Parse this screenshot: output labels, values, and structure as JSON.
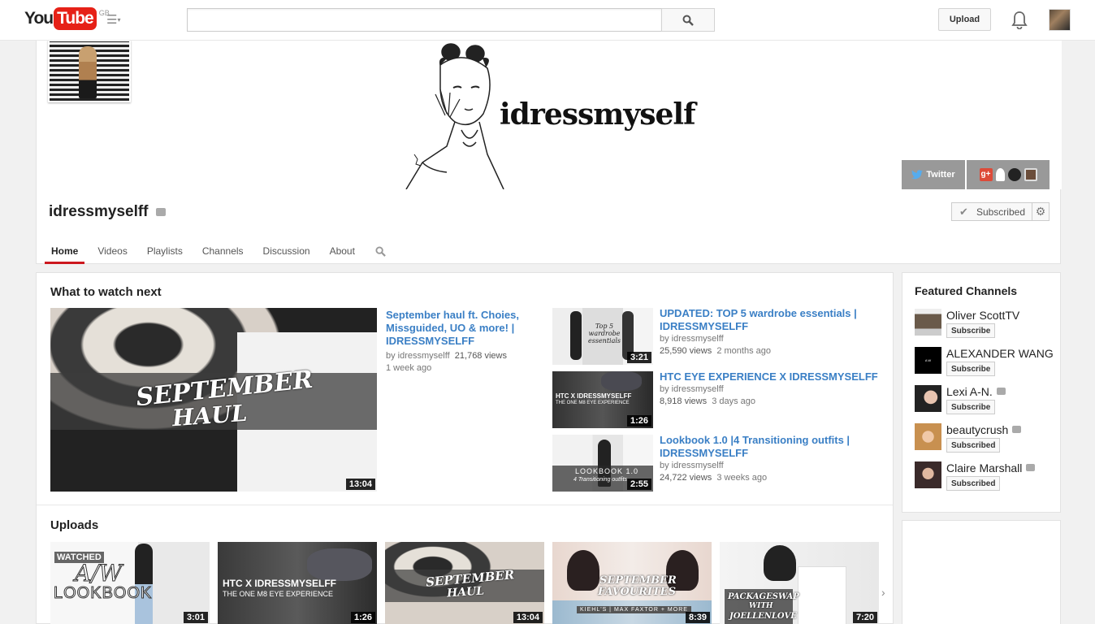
{
  "masthead": {
    "logo_you": "You",
    "logo_tube": "Tube",
    "region": "GB",
    "search_placeholder": "",
    "upload_label": "Upload"
  },
  "channel": {
    "banner_name": "idressmyself",
    "title": "idressmyselff",
    "social": {
      "twitter_label": "Twitter"
    },
    "subscribe_label": "Subscribed"
  },
  "tabs": [
    {
      "label": "Home",
      "active": true
    },
    {
      "label": "Videos"
    },
    {
      "label": "Playlists"
    },
    {
      "label": "Channels"
    },
    {
      "label": "Discussion"
    },
    {
      "label": "About"
    }
  ],
  "what_to_watch": {
    "heading": "What to watch next",
    "featured": {
      "thumb_text_1": "SEPTEMBER",
      "thumb_text_2": "HAUL",
      "duration": "13:04",
      "title": "September haul ft. Choies, Missguided, UO & more! | IDRESSMYSELFF",
      "by": "by idressmyselff",
      "views": "21,768 views",
      "age": "1 week ago"
    },
    "list": [
      {
        "title": "UPDATED: TOP 5 wardrobe essentials | IDRESSMYSELFF",
        "by": "by idressmyselff",
        "views": "25,590 views",
        "age": "2 months ago",
        "duration": "3:21",
        "thumb_text": "Top 5 wardrobe essentials"
      },
      {
        "title": "HTC EYE EXPERIENCE X IDRESSMYSELFF",
        "by": "by idressmyselff",
        "views": "8,918 views",
        "age": "3 days ago",
        "duration": "1:26",
        "thumb_text": "HTC X IDRESSMYSELFF",
        "thumb_sub": "THE ONE M8 EYE EXPERIENCE"
      },
      {
        "title": "Lookbook 1.0 |4 Transitioning outfits | IDRESSMYSELFF",
        "by": "by idressmyselff",
        "views": "24,722 views",
        "age": "3 weeks ago",
        "duration": "2:55",
        "thumb_text": "LOOKBOOK 1.0",
        "thumb_sub": "4 Transitioning outfits"
      }
    ]
  },
  "uploads": {
    "heading": "Uploads",
    "items": [
      {
        "watched": "WATCHED",
        "thumb_text": "A/W",
        "thumb_sub": "LOOKBOOK",
        "duration": "3:01"
      },
      {
        "thumb_text": "HTC X IDRESSMYSELFF",
        "thumb_sub": "THE ONE M8 EYE EXPERIENCE",
        "duration": "1:26"
      },
      {
        "thumb_text": "SEPTEMBER",
        "thumb_sub": "HAUL",
        "duration": "13:04"
      },
      {
        "thumb_text": "SEPTEMBER",
        "thumb_sub": "FAVOURITES",
        "thumb_sub2": "KIEHL'S | MAX FAXTOR + MORE",
        "duration": "8:39"
      },
      {
        "thumb_text": "PACKAGESWAP",
        "thumb_sub": "WITH",
        "thumb_sub2": "JOELLENLOVE",
        "duration": "7:20"
      }
    ]
  },
  "featured_channels": {
    "heading": "Featured Channels",
    "items": [
      {
        "name": "Oliver ScottTV",
        "button": "Subscribe"
      },
      {
        "name": "ALEXANDER WANG",
        "button": "Subscribe"
      },
      {
        "name": "Lexi A-N.",
        "button": "Subscribe",
        "verified": true
      },
      {
        "name": "beautycrush",
        "button": "Subscribed",
        "verified": true
      },
      {
        "name": "Claire Marshall",
        "button": "Subscribed",
        "verified": true
      }
    ]
  },
  "colors": {
    "brand_red": "#e62117",
    "link_blue": "#3a7fc5",
    "tab_active": "#cc181e"
  }
}
